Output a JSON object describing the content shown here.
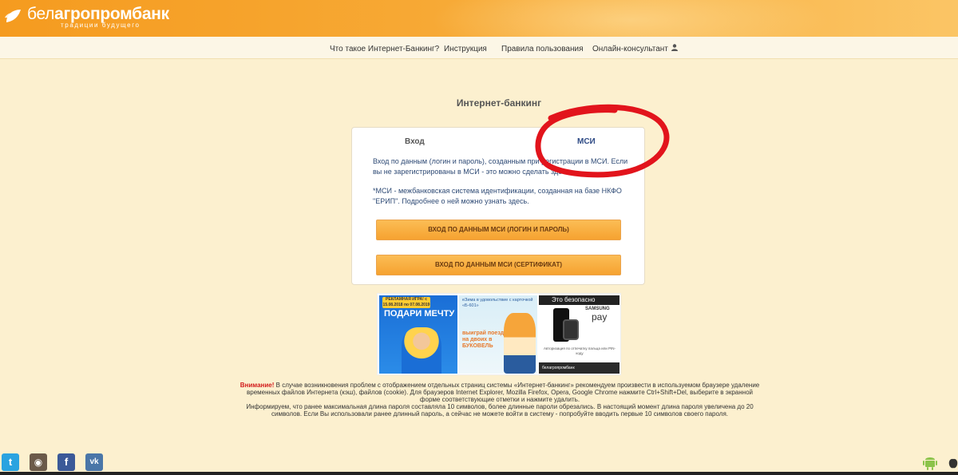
{
  "header": {
    "brand_prefix": "бел",
    "brand_bold": "агропром",
    "brand_suffix": "банк",
    "tagline": "традиции будущего"
  },
  "nav": {
    "items": [
      {
        "label": "Что такое Интернет-Банкинг?"
      },
      {
        "label": "Инструкция"
      },
      {
        "label": "Правила пользования"
      },
      {
        "label": "Онлайн-консультант"
      }
    ]
  },
  "page_title": "Интернет-банкинг",
  "card": {
    "tab_login": "Вход",
    "tab_msi": "МСИ",
    "description": "Вход по данным (логин и пароль), созданным при регистрации в МСИ. Если вы не зарегистрированы в МСИ - это можно сделать здесь.",
    "note": "*МСИ - межбанковская система идентификации, созданная на базе НКФО \"ЕРИП\". Подробнее о ней можно узнать здесь.",
    "button_login_password": "ВХОД ПО ДАННЫМ МСИ (ЛОГИН И ПАРОЛЬ)",
    "button_certificate": "ВХОД ПО ДАННЫМ МСИ (СЕРТИФИКАТ)"
  },
  "banners": {
    "b1_ribbon": "РЕКЛАМНАЯ ИГРА! с 15.08.2018 по 07.08.2019",
    "b1_heading": "ПОДАРИ МЕЧТУ",
    "b2_text": "еЗима в удовольствие с карточкой «Б-601»",
    "b2_promo": "выиграй поездку на двоих в БУКОВЕЛЬ",
    "b3_heading": "Это безопасно",
    "b3_brand": "SAMSUNG",
    "b3_pay": "pay",
    "b3_small": "Авторизация по отпечатку пальца или PIN-коду",
    "b3_footer": "белагропромбанк"
  },
  "notice": {
    "warning_label": "Внимание!",
    "text": " В случае возникновения проблем с отображением отдельных страниц системы «Интернет-банкинг» рекомендуем произвести в используемом браузере удаление временных файлов Интернета (кэш), файлов (cookie). Для браузеров Internet Explorer, Mozilla Firefox, Opera, Google Chrome нажмите Ctrl+Shift+Del, выберите в экранной форме соответствующие отметки и нажмите удалить.",
    "text2": "Информируем, что ранее максимальная длина пароля составляла 10 символов, более длинные пароли обрезались. В настоящий момент длина пароля увеличена до 20 символов. Если Вы использовали ранее длинный пароль, а сейчас не можете войти в систему - попробуйте вводить первые 10 символов своего пароля."
  },
  "social": [
    {
      "icon": "twitter-icon",
      "glyph": "t",
      "color": "#2aa3e0"
    },
    {
      "icon": "instagram-icon",
      "glyph": "◉",
      "color": "#6b5a4a"
    },
    {
      "icon": "facebook-icon",
      "glyph": "f",
      "color": "#3b5998"
    },
    {
      "icon": "vk-icon",
      "glyph": "vk",
      "color": "#4a76a8"
    }
  ]
}
